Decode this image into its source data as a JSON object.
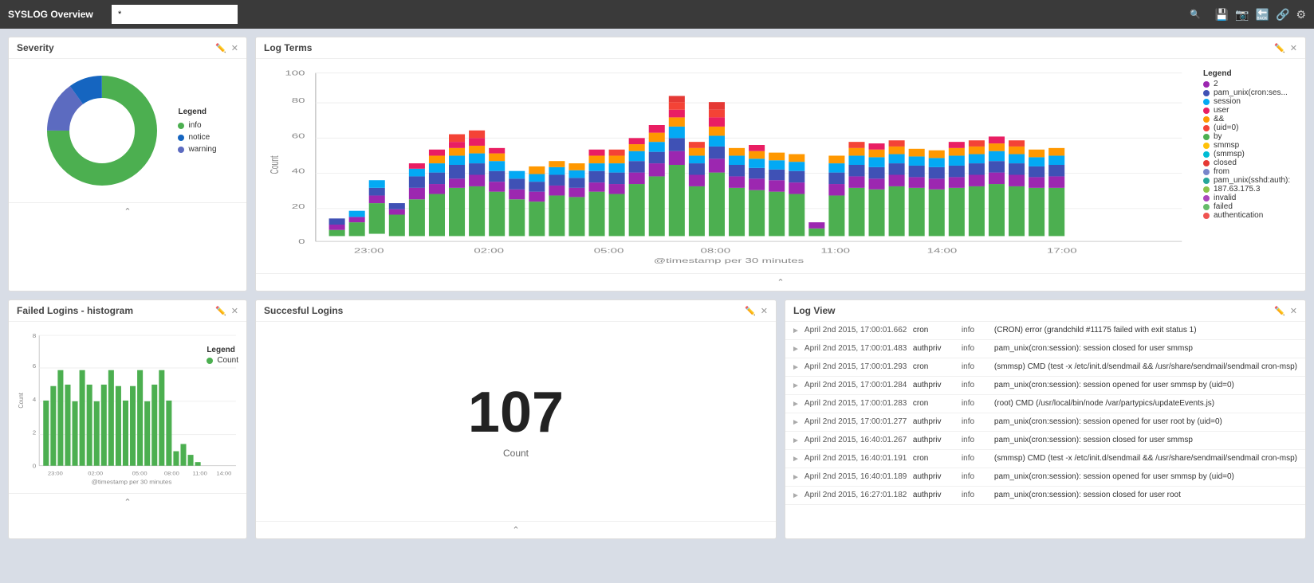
{
  "topbar": {
    "title": "SYSLOG Overview",
    "search_value": "*",
    "search_placeholder": ""
  },
  "severity_panel": {
    "title": "Severity",
    "legend_title": "Legend",
    "legend_items": [
      {
        "label": "info",
        "color": "#4caf50"
      },
      {
        "label": "notice",
        "color": "#1565c0"
      },
      {
        "label": "warning",
        "color": "#5c6bc0"
      }
    ],
    "donut_segments": [
      {
        "label": "info",
        "color": "#4caf50",
        "percent": 75
      },
      {
        "label": "notice",
        "color": "#1565c0",
        "percent": 10
      },
      {
        "label": "warning",
        "color": "#5c6bc0",
        "percent": 15
      }
    ]
  },
  "log_terms_panel": {
    "title": "Log Terms",
    "legend_title": "Legend",
    "legend_items": [
      {
        "label": "2",
        "color": "#9c27b0"
      },
      {
        "label": "pam_unix(cron:ses...",
        "color": "#3f51b5"
      },
      {
        "label": "session",
        "color": "#03a9f4"
      },
      {
        "label": "user",
        "color": "#e91e63"
      },
      {
        "label": "&&",
        "color": "#ff9800"
      },
      {
        "label": "(uid=0)",
        "color": "#f44336"
      },
      {
        "label": "by",
        "color": "#4caf50"
      },
      {
        "label": "smmsp",
        "color": "#ffc107"
      },
      {
        "label": "(smmsp)",
        "color": "#00bcd4"
      },
      {
        "label": "closed",
        "color": "#e53935"
      },
      {
        "label": "from",
        "color": "#7986cb"
      },
      {
        "label": "pam_unix(sshd:auth):",
        "color": "#26a69a"
      },
      {
        "label": "187.63.175.3",
        "color": "#8bc34a"
      },
      {
        "label": "invalid",
        "color": "#ab47bc"
      },
      {
        "label": "failed",
        "color": "#66bb6a"
      },
      {
        "label": "authentication",
        "color": "#ef5350"
      }
    ],
    "y_axis": {
      "max": 100,
      "ticks": [
        0,
        20,
        40,
        60,
        80,
        100
      ]
    },
    "x_axis_label": "@timestamp per 30 minutes",
    "x_ticks": [
      "23:00",
      "02:00",
      "05:00",
      "08:00",
      "11:00",
      "14:00",
      "17:00"
    ]
  },
  "failed_logins_panel": {
    "title": "Failed Logins - histogram",
    "legend_title": "Legend",
    "legend_items": [
      {
        "label": "Count",
        "color": "#4caf50"
      }
    ],
    "y_axis": {
      "max": 8,
      "ticks": [
        0,
        2,
        4,
        6,
        8
      ]
    },
    "x_axis_label": "@timestamp per 30 minutes",
    "x_ticks": [
      "23:00",
      "02:00",
      "05:00",
      "08:00",
      "11:00",
      "14:00"
    ]
  },
  "successful_logins_panel": {
    "title": "Succesful Logins",
    "count": "107",
    "count_label": "Count"
  },
  "log_view_panel": {
    "title": "Log View",
    "rows": [
      {
        "timestamp": "April 2nd 2015, 17:00:01.662",
        "program": "cron",
        "level": "info",
        "message": "(CRON) error (grandchild #11175 failed with exit status 1)"
      },
      {
        "timestamp": "April 2nd 2015, 17:00:01.483",
        "program": "authpriv",
        "level": "info",
        "message": "pam_unix(cron:session): session closed for user smmsp"
      },
      {
        "timestamp": "April 2nd 2015, 17:00:01.293",
        "program": "cron",
        "level": "info",
        "message": "(smmsp) CMD (test -x /etc/init.d/sendmail && /usr/share/sendmail/sendmail cron-msp)"
      },
      {
        "timestamp": "April 2nd 2015, 17:00:01.284",
        "program": "authpriv",
        "level": "info",
        "message": "pam_unix(cron:session): session opened for user smmsp by (uid=0)"
      },
      {
        "timestamp": "April 2nd 2015, 17:00:01.283",
        "program": "cron",
        "level": "info",
        "message": "(root) CMD (/usr/local/bin/node /var/partypics/updateEvents.js)"
      },
      {
        "timestamp": "April 2nd 2015, 17:00:01.277",
        "program": "authpriv",
        "level": "info",
        "message": "pam_unix(cron:session): session opened for user root by (uid=0)"
      },
      {
        "timestamp": "April 2nd 2015, 16:40:01.267",
        "program": "authpriv",
        "level": "info",
        "message": "pam_unix(cron:session): session closed for user smmsp"
      },
      {
        "timestamp": "April 2nd 2015, 16:40:01.191",
        "program": "cron",
        "level": "info",
        "message": "(smmsp) CMD (test -x /etc/init.d/sendmail && /usr/share/sendmail/sendmail cron-msp)"
      },
      {
        "timestamp": "April 2nd 2015, 16:40:01.189",
        "program": "authpriv",
        "level": "info",
        "message": "pam_unix(cron:session): session opened for user smmsp by (uid=0)"
      },
      {
        "timestamp": "April 2nd 2015, 16:27:01.182",
        "program": "authpriv",
        "level": "info",
        "message": "pam_unix(cron:session): session closed for user root"
      }
    ]
  }
}
